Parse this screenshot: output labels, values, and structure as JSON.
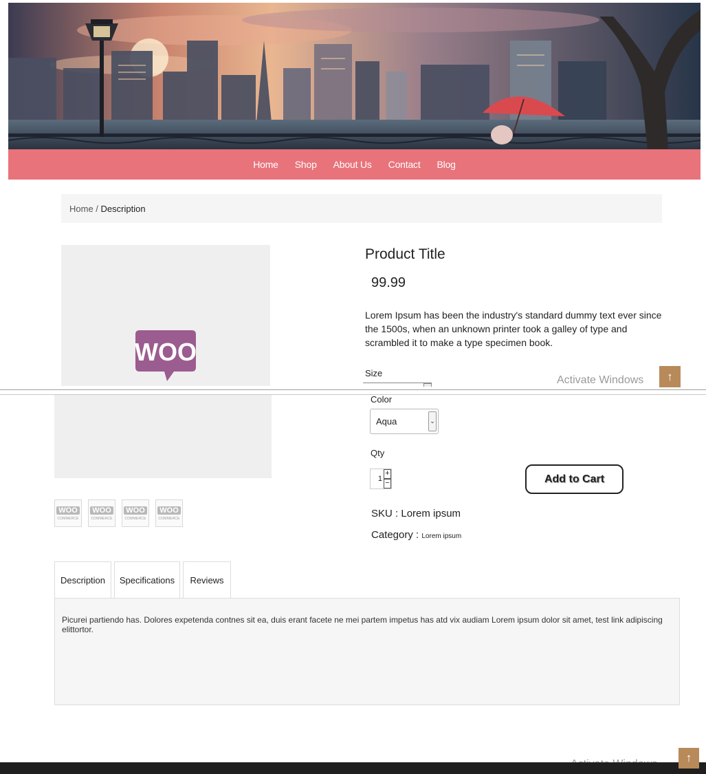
{
  "nav": {
    "items": [
      "Home",
      "Shop",
      "About Us",
      "Contact",
      "Blog"
    ]
  },
  "breadcrumb": {
    "home": "Home",
    "separator": " / ",
    "current": "Description"
  },
  "product": {
    "title": "Product Title",
    "price": "99.99",
    "description": "Lorem Ipsum has been the industry's standard dummy text ever since the 1500s, when an unknown printer took a galley of type and scrambled it to make a type specimen book.",
    "size_label": "Size",
    "color_label": "Color",
    "color_value": "Aqua",
    "qty_label": "Qty",
    "qty_value": "1",
    "add_to_cart": "Add to Cart",
    "sku_label": "SKU : ",
    "sku_value": "Lorem ipsum",
    "category_label": "Category : ",
    "category_value": "Lorem ipsum",
    "image_logo": "WOO",
    "thumb_logo": "WOO",
    "thumb_caption": "COMMERCE"
  },
  "tabs": {
    "items": [
      "Description",
      "Specifications",
      "Reviews"
    ],
    "active": "Description",
    "content": "Picurei partiendo has. Dolores expetenda contnes sit ea, duis erant facete ne mei partem impetus has atd vix audiam Lorem ipsum dolor sit amet, test link adipiscing elittortor."
  },
  "overlay": {
    "watermark": "Activate Windows",
    "scroll_top": "↑"
  },
  "colors": {
    "nav": "#e8737b",
    "footer": "#1f1f1f",
    "woo": "#9b5c8f",
    "scroll_top": "#b88a5a"
  },
  "icons": [
    "woocommerce-logo",
    "arrow-up-icon",
    "chevron-down-icon",
    "plus-icon",
    "minus-icon"
  ]
}
